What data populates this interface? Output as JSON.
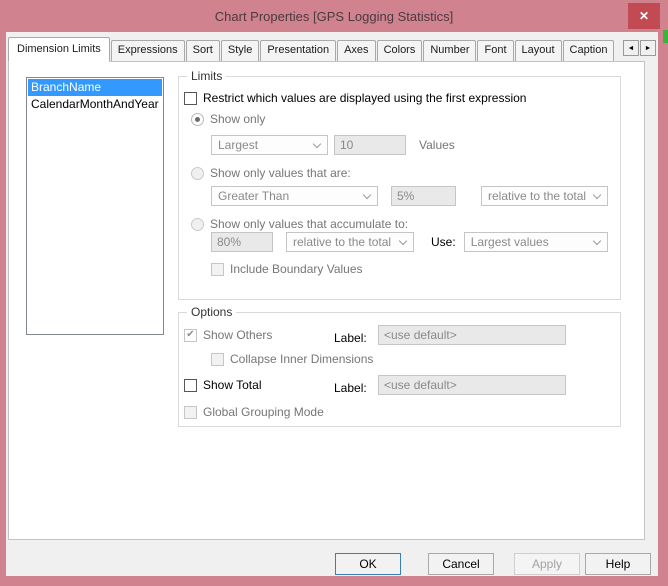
{
  "window": {
    "title": "Chart Properties [GPS Logging Statistics]",
    "close_glyph": "✕"
  },
  "colors": {
    "titlebar_pink": "#d0838f",
    "close_button_red": "#c24a52",
    "list_selection_blue": "#3399ff",
    "default_button_border_blue": "#3c7fb1",
    "desktop_sliver_green": "#3cb43c"
  },
  "tabs": [
    {
      "label": "Dimension Limits",
      "active": true
    },
    {
      "label": "Expressions",
      "active": false
    },
    {
      "label": "Sort",
      "active": false
    },
    {
      "label": "Style",
      "active": false
    },
    {
      "label": "Presentation",
      "active": false
    },
    {
      "label": "Axes",
      "active": false
    },
    {
      "label": "Colors",
      "active": false
    },
    {
      "label": "Number",
      "active": false
    },
    {
      "label": "Font",
      "active": false
    },
    {
      "label": "Layout",
      "active": false
    },
    {
      "label": "Caption",
      "active": false
    }
  ],
  "tab_scroller": {
    "left_glyph": "◄",
    "right_glyph": "►"
  },
  "dimension_list": {
    "items": [
      {
        "label": "BranchName",
        "selected": true
      },
      {
        "label": "CalendarMonthAndYear",
        "selected": false
      }
    ]
  },
  "limits": {
    "group_title": "Limits",
    "restrict_label": "Restrict which values are displayed using the first expression",
    "restrict_checked": false,
    "show_only": {
      "label": "Show only",
      "selected": true,
      "mode_value": "Largest",
      "count_value": "10",
      "suffix_label": "Values"
    },
    "show_values_that_are": {
      "label": "Show only values that are:",
      "selected": false,
      "operator_value": "Greater Than",
      "amount_value": "5%",
      "relative_value": "relative to the total"
    },
    "accumulate": {
      "label": "Show only values that accumulate to:",
      "selected": false,
      "amount_value": "80%",
      "relative_value": "relative to the total",
      "use_label": "Use:",
      "use_value": "Largest values"
    },
    "include_boundary_label": "Include Boundary Values",
    "include_boundary_checked": false
  },
  "options": {
    "group_title": "Options",
    "show_others_label": "Show Others",
    "show_others_checked": true,
    "others_label": "Label:",
    "others_value": "<use default>",
    "collapse_label": "Collapse Inner Dimensions",
    "collapse_checked": false,
    "show_total_label": "Show Total",
    "show_total_checked": false,
    "total_label": "Label:",
    "total_value": "<use default>",
    "global_grouping_label": "Global Grouping Mode",
    "global_grouping_checked": false
  },
  "footer": {
    "ok": "OK",
    "cancel": "Cancel",
    "apply": "Apply",
    "help": "Help"
  },
  "glyphs": {
    "check": "✔"
  }
}
